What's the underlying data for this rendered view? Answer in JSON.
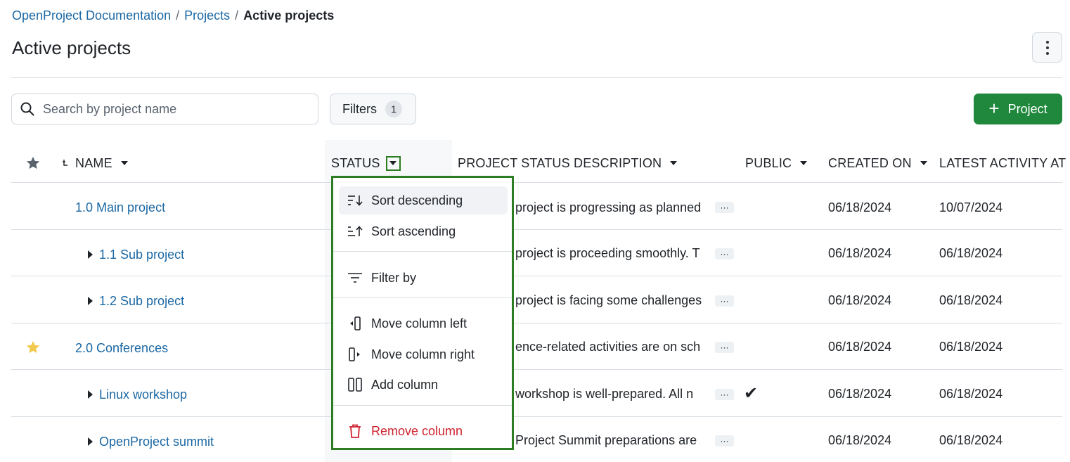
{
  "breadcrumb": {
    "items": [
      "OpenProject Documentation",
      "Projects"
    ],
    "separator": "/",
    "current": "Active projects"
  },
  "page_title": "Active projects",
  "search": {
    "placeholder": "Search by project name",
    "value": ""
  },
  "filters": {
    "label": "Filters",
    "count": "1"
  },
  "add_project": {
    "label": "Project"
  },
  "columns": {
    "name": "NAME",
    "status": "STATUS",
    "description": "PROJECT STATUS DESCRIPTION",
    "public": "PUBLIC",
    "created_on": "CREATED ON",
    "latest_activity": "LATEST ACTIVITY AT"
  },
  "rows": [
    {
      "name": "1.0 Main project",
      "description": "project is progressing as planned",
      "public": "",
      "created_on": "06/18/2024",
      "latest_activity": "10/07/2024",
      "favorite": false,
      "child": false
    },
    {
      "name": "1.1 Sub project",
      "description": "project is proceeding smoothly. T",
      "public": "",
      "created_on": "06/18/2024",
      "latest_activity": "06/18/2024",
      "favorite": false,
      "child": true
    },
    {
      "name": "1.2 Sub project",
      "description": "project is facing some challenges",
      "public": "",
      "created_on": "06/18/2024",
      "latest_activity": "06/18/2024",
      "favorite": false,
      "child": true
    },
    {
      "name": "2.0 Conferences",
      "description": "ence-related activities are on sch",
      "public": "",
      "created_on": "06/18/2024",
      "latest_activity": "06/18/2024",
      "favorite": true,
      "child": false
    },
    {
      "name": "Linux workshop",
      "description": "workshop is well-prepared. All n",
      "public": "✔",
      "created_on": "06/18/2024",
      "latest_activity": "06/18/2024",
      "favorite": false,
      "child": true
    },
    {
      "name": "OpenProject summit",
      "description": "Project Summit preparations are",
      "public": "",
      "created_on": "06/18/2024",
      "latest_activity": "06/18/2024",
      "favorite": false,
      "child": true
    }
  ],
  "ellipsis_label": "···",
  "dropdown": {
    "sort_descending": "Sort descending",
    "sort_ascending": "Sort ascending",
    "filter_by": "Filter by",
    "move_left": "Move column left",
    "move_right": "Move column right",
    "add_column": "Add column",
    "remove_column": "Remove column"
  },
  "colors": {
    "link": "#1a67a3",
    "primary": "#1f883d",
    "danger": "#cf222e",
    "highlight_border": "#2d7d22",
    "favorite": "#f2c94c"
  }
}
